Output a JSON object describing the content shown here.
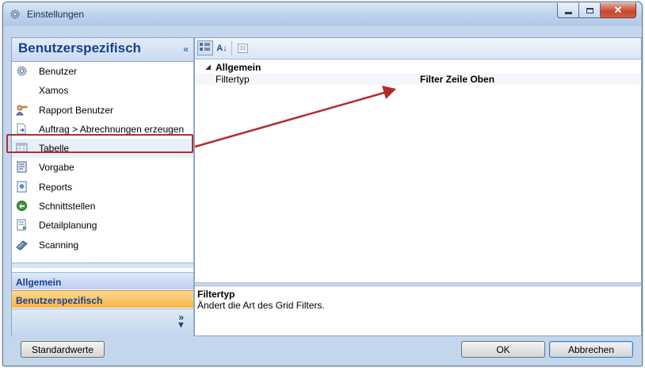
{
  "window": {
    "title": "Einstellungen",
    "icon": "gear-icon"
  },
  "nav": {
    "header": "Benutzerspezifisch",
    "collapse_glyph": "«",
    "items": [
      {
        "label": "Benutzer",
        "icon": "gear-icon"
      },
      {
        "label": "Xamos",
        "icon": ""
      },
      {
        "label": "Rapport Benutzer",
        "icon": "user-key-icon"
      },
      {
        "label": "Auftrag > Abrechnungen erzeugen",
        "icon": "document-arrow-icon"
      },
      {
        "label": "Tabelle",
        "icon": "table-icon"
      },
      {
        "label": "Vorgabe",
        "icon": "form-icon"
      },
      {
        "label": "Reports",
        "icon": "report-icon"
      },
      {
        "label": "Schnittstellen",
        "icon": "interface-icon"
      },
      {
        "label": "Detailplanung",
        "icon": "planning-icon"
      },
      {
        "label": "Scanning",
        "icon": "scanner-icon"
      }
    ],
    "grip_glyph": "··········",
    "sections": [
      {
        "label": "Allgemein"
      },
      {
        "label": "Benutzerspezifisch"
      }
    ],
    "more_glyph": "»"
  },
  "propertygrid": {
    "category": "Allgemein",
    "category_arrow": "◢",
    "properties": [
      {
        "name": "Filtertyp",
        "value": "Filter Zeile Oben"
      }
    ],
    "description": {
      "title": "Filtertyp",
      "text": "Ändert die Art des Grid Filters."
    }
  },
  "buttons": {
    "defaults": "Standardwerte",
    "ok": "OK",
    "cancel": "Abbrechen"
  },
  "colors": {
    "accent": "#15428b",
    "selected_section": "#f7b546",
    "highlight": "#b52b2b"
  }
}
